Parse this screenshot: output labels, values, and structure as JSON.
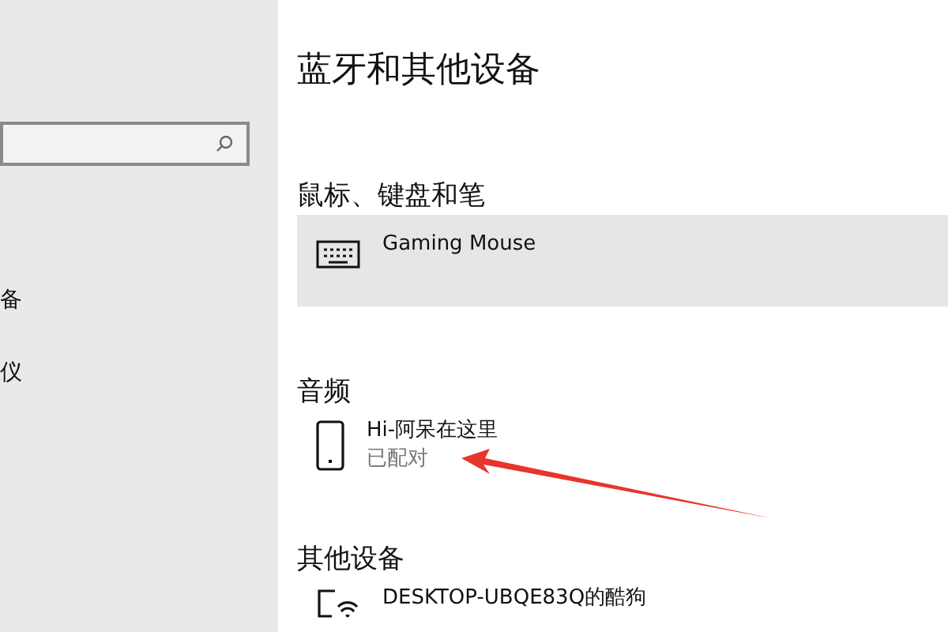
{
  "sidebar": {
    "items": [
      {
        "label": "备"
      },
      {
        "label": "仪"
      }
    ]
  },
  "page": {
    "title": "蓝牙和其他设备",
    "sections": [
      {
        "heading": "鼠标、键盘和笔",
        "devices": [
          {
            "kind": "keyboard",
            "name": "Gaming Mouse",
            "selected": true
          }
        ]
      },
      {
        "heading": "音频",
        "devices": [
          {
            "kind": "phone",
            "name": "Hi-阿呆在这里",
            "status": "已配对",
            "selected": false
          }
        ]
      },
      {
        "heading": "其他设备",
        "devices": [
          {
            "kind": "display",
            "name": "DESKTOP-UBQE83Q的酷狗",
            "selected": false
          }
        ]
      }
    ]
  }
}
